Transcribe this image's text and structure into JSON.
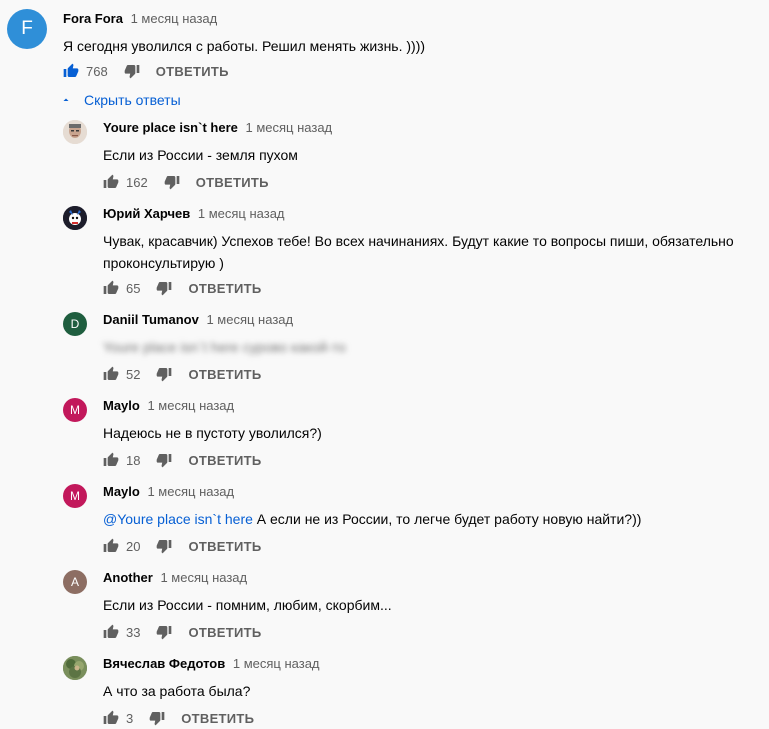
{
  "top_comment": {
    "avatar_letter": "F",
    "avatar_color": "#2f8fd8",
    "author": "Fora Fora",
    "time": "1 месяц назад",
    "text": "Я сегодня уволился с работы. Решил менять жизнь. ))))",
    "likes": "768",
    "reply_label": "ОТВЕТИТЬ",
    "like_color": "#065fd4"
  },
  "hide_replies_label": "Скрыть ответы",
  "replies": [
    {
      "author": "Youre place isn`t here",
      "time": "1 месяц назад",
      "text": "Если из России - земля пухом",
      "likes": "162",
      "reply_label": "ОТВЕТИТЬ",
      "avatar_type": "photo-face"
    },
    {
      "author": "Юрий Харчев",
      "time": "1 месяц назад",
      "text": "Чувак, красавчик) Успехов тебе! Во всех начинаниях. Будут какие то вопросы пиши, обязательно проконсультирую )",
      "likes": "65",
      "reply_label": "ОТВЕТИТЬ",
      "avatar_type": "photo-character"
    },
    {
      "author": "Daniil Tumanov",
      "time": "1 месяц назад",
      "text": "Youre place isn`t here сурово какой-то",
      "likes": "52",
      "reply_label": "ОТВЕТИТЬ",
      "avatar_letter": "D",
      "avatar_color": "#1f5e3f"
    },
    {
      "author": "Maylo",
      "time": "1 месяц назад",
      "text": "Надеюсь не в пустоту уволился?)",
      "likes": "18",
      "reply_label": "ОТВЕТИТЬ",
      "avatar_letter": "M",
      "avatar_color": "#c2185b"
    },
    {
      "author": "Maylo",
      "time": "1 месяц назад",
      "mention": "@Youre place isn`t here",
      "text": " А если не из России, то легче будет работу новую найти?))",
      "likes": "20",
      "reply_label": "ОТВЕТИТЬ",
      "avatar_letter": "M",
      "avatar_color": "#c2185b"
    },
    {
      "author": "Another",
      "time": "1 месяц назад",
      "text": "Если из России - помним, любим, скорбим...",
      "likes": "33",
      "reply_label": "ОТВЕТИТЬ",
      "avatar_letter": "A",
      "avatar_color": "#8d6e63"
    },
    {
      "author": "Вячеслав Федотов",
      "time": "1 месяц назад",
      "text": "А что за работа была?",
      "likes": "3",
      "reply_label": "ОТВЕТИТЬ",
      "avatar_type": "photo-nature"
    }
  ]
}
